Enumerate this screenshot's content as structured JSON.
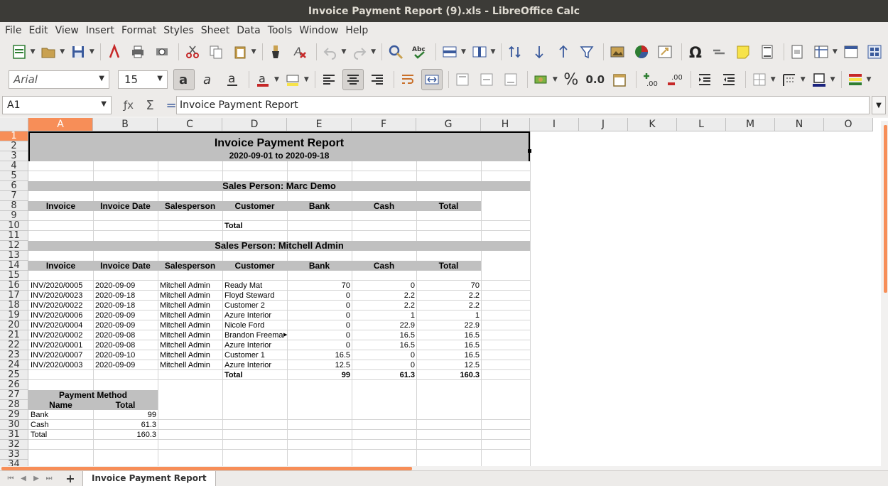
{
  "window": {
    "title": "Invoice Payment Report (9).xls - LibreOffice Calc"
  },
  "menu": [
    "File",
    "Edit",
    "View",
    "Insert",
    "Format",
    "Styles",
    "Sheet",
    "Data",
    "Tools",
    "Window",
    "Help"
  ],
  "format_toolbar": {
    "font_name": "Arial",
    "font_size": "15",
    "percent_label": "%",
    "decimal_label": "0.0"
  },
  "formula_bar": {
    "name_box": "A1",
    "content": "Invoice Payment Report"
  },
  "columns": [
    "A",
    "B",
    "C",
    "D",
    "E",
    "F",
    "G",
    "H",
    "I",
    "J",
    "K",
    "L",
    "M",
    "N",
    "O"
  ],
  "rows": [
    "1",
    "2",
    "3",
    "4",
    "5",
    "6",
    "7",
    "8",
    "9",
    "10",
    "11",
    "12",
    "13",
    "14",
    "15",
    "16",
    "17",
    "18",
    "19",
    "20",
    "21",
    "22",
    "23",
    "24",
    "25",
    "26",
    "27",
    "28",
    "29",
    "30",
    "31",
    "32",
    "33",
    "34"
  ],
  "sheet": {
    "title": "Invoice Payment Report",
    "date_range": "2020-09-01 to 2020-09-18",
    "section1_title": "Sales Person: Marc Demo",
    "section2_title": "Sales Person: Mitchell Admin",
    "table_headers": [
      "Invoice",
      "Invoice Date",
      "Salesperson",
      "Customer",
      "Bank",
      "Cash",
      "Total"
    ],
    "section1_total_label": "Total",
    "section2_rows": [
      [
        "INV/2020/0005",
        "2020-09-09",
        "Mitchell Admin",
        "Ready Mat",
        "70",
        "0",
        "70"
      ],
      [
        "INV/2020/0023",
        "2020-09-18",
        "Mitchell Admin",
        "Floyd Steward",
        "0",
        "2.2",
        "2.2"
      ],
      [
        "INV/2020/0022",
        "2020-09-18",
        "Mitchell Admin",
        "Customer 2",
        "0",
        "2.2",
        "2.2"
      ],
      [
        "INV/2020/0006",
        "2020-09-09",
        "Mitchell Admin",
        "Azure Interior",
        "0",
        "1",
        "1"
      ],
      [
        "INV/2020/0004",
        "2020-09-09",
        "Mitchell Admin",
        "Nicole Ford",
        "0",
        "22.9",
        "22.9"
      ],
      [
        "INV/2020/0002",
        "2020-09-08",
        "Mitchell Admin",
        "Brandon Freeman",
        "0",
        "16.5",
        "16.5"
      ],
      [
        "INV/2020/0001",
        "2020-09-08",
        "Mitchell Admin",
        "Azure Interior",
        "0",
        "16.5",
        "16.5"
      ],
      [
        "INV/2020/0007",
        "2020-09-10",
        "Mitchell Admin",
        "Customer 1",
        "16.5",
        "0",
        "16.5"
      ],
      [
        "INV/2020/0003",
        "2020-09-09",
        "Mitchell Admin",
        "Azure Interior",
        "12.5",
        "0",
        "12.5"
      ]
    ],
    "section2_total": {
      "label": "Total",
      "bank": "99",
      "cash": "61.3",
      "total": "160.3"
    },
    "payment_method": {
      "title": "Payment Method",
      "headers": [
        "Name",
        "Total"
      ],
      "rows": [
        [
          "Bank",
          "99"
        ],
        [
          "Cash",
          "61.3"
        ],
        [
          "Total",
          "160.3"
        ]
      ]
    }
  },
  "sheet_tabs": [
    {
      "label": "Invoice Payment Report",
      "active": true
    }
  ],
  "accent_color": "#f78e58",
  "header_band_color": "#c0c0c0"
}
